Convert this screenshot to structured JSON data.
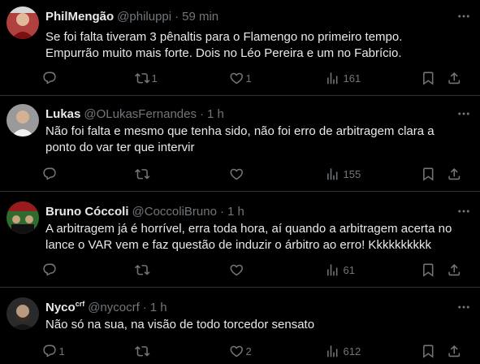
{
  "tweets": [
    {
      "name": "PhilMengão",
      "name_sup": "",
      "handle": "@philuppi",
      "time": "59 min",
      "text": [
        "Se foi falta tiveram 3 pênaltis para o Flamengo no primeiro tempo.",
        "Empurrão muito mais forte. Dois no Léo Pereira e um no Fabrício."
      ],
      "replies": "",
      "retweets": "1",
      "likes": "1",
      "views": "161"
    },
    {
      "name": "Lukas",
      "name_sup": "",
      "handle": "@OLukasFernandes",
      "time": "1 h",
      "text": [
        "Não foi falta e mesmo que tenha sido, não foi erro de arbitragem clara a",
        "ponto do var ter que intervir"
      ],
      "replies": "",
      "retweets": "",
      "likes": "",
      "views": "155"
    },
    {
      "name": "Bruno Cóccoli",
      "name_sup": "",
      "handle": "@CoccoliBruno",
      "time": "1 h",
      "text": [
        "A arbitragem já é horrível, erra toda hora, aí quando a arbitragem acerta no",
        "lance o VAR vem e faz questão de induzir o árbitro ao erro! Kkkkkkkkkk"
      ],
      "replies": "",
      "retweets": "",
      "likes": "",
      "views": "61"
    },
    {
      "name": "Nyco",
      "name_sup": "crf",
      "handle": "@nycocrf",
      "time": "1 h",
      "text": [
        "Não só na sua, na visão de todo torcedor sensato"
      ],
      "replies": "1",
      "retweets": "",
      "likes": "2",
      "views": "612"
    }
  ],
  "icons": {
    "more": "more-dots-icon",
    "reply": "reply-icon",
    "retweet": "retweet-icon",
    "like": "heart-icon",
    "views": "views-bar-icon",
    "bookmark": "bookmark-icon",
    "share": "share-icon"
  },
  "colors": {
    "background": "#000000",
    "text": "#e7e9ea",
    "secondary": "#71767b",
    "divider": "#2f3336"
  }
}
